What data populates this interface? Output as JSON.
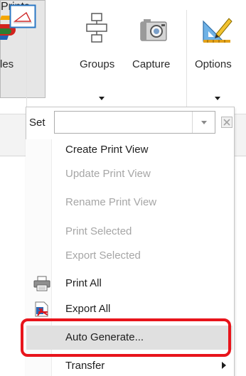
{
  "ribbon": {
    "partial_label": "les",
    "buttons": [
      {
        "label": "Prints",
        "icon": "print-view-icon",
        "has_dropdown": true,
        "active": true
      },
      {
        "label": "Groups",
        "icon": "groups-icon",
        "has_dropdown": true
      },
      {
        "label": "Capture",
        "icon": "camera-icon",
        "has_dropdown": false
      },
      {
        "label": "Options",
        "icon": "ruler-pencil-icon",
        "has_dropdown": true
      }
    ]
  },
  "menu": {
    "set_label": "Set",
    "set_value": "",
    "items": [
      {
        "label": "Create Print View",
        "enabled": true,
        "icon": ""
      },
      {
        "label": "Update Print View",
        "enabled": false,
        "icon": ""
      },
      {
        "label": "Rename Print View",
        "enabled": false,
        "icon": ""
      },
      {
        "label": "Print Selected",
        "enabled": false,
        "icon": ""
      },
      {
        "label": "Export Selected",
        "enabled": false,
        "icon": ""
      },
      {
        "label": "Print All",
        "enabled": true,
        "icon": "printer-icon"
      },
      {
        "label": "Export All",
        "enabled": true,
        "icon": "pdf-export-icon"
      },
      {
        "label": "Auto Generate...",
        "enabled": true,
        "icon": "",
        "highlighted": true
      },
      {
        "label": "Transfer",
        "enabled": true,
        "icon": "",
        "has_submenu": true
      }
    ]
  },
  "colors": {
    "highlight_outline": "#e8141b",
    "disabled_text": "#a6a6a6",
    "hover_background": "#e0e0e0"
  }
}
